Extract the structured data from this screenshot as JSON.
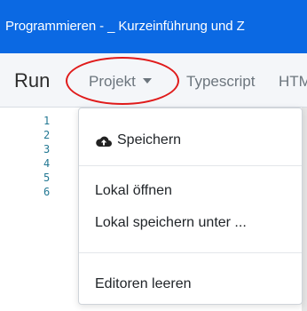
{
  "titlebar": {
    "text": "Programmieren - _ Kurzeinführung und Z"
  },
  "navbar": {
    "run": "Run",
    "projekt": "Projekt",
    "typescript": "Typescript",
    "htm": "HTM"
  },
  "gutter": {
    "lines": [
      "1",
      "2",
      "3",
      "4",
      "5",
      "6"
    ]
  },
  "menu": {
    "save": "Speichern",
    "open_local": "Lokal öffnen",
    "save_local_as": "Lokal speichern unter ...",
    "clear_editors": "Editoren leeren"
  },
  "icons": {
    "save": "cloud-upload-icon",
    "caret": "caret-down-icon"
  },
  "colors": {
    "titlebar": "#0b69e3",
    "highlight": "#e01b1b",
    "line_numbers": "#237893"
  }
}
